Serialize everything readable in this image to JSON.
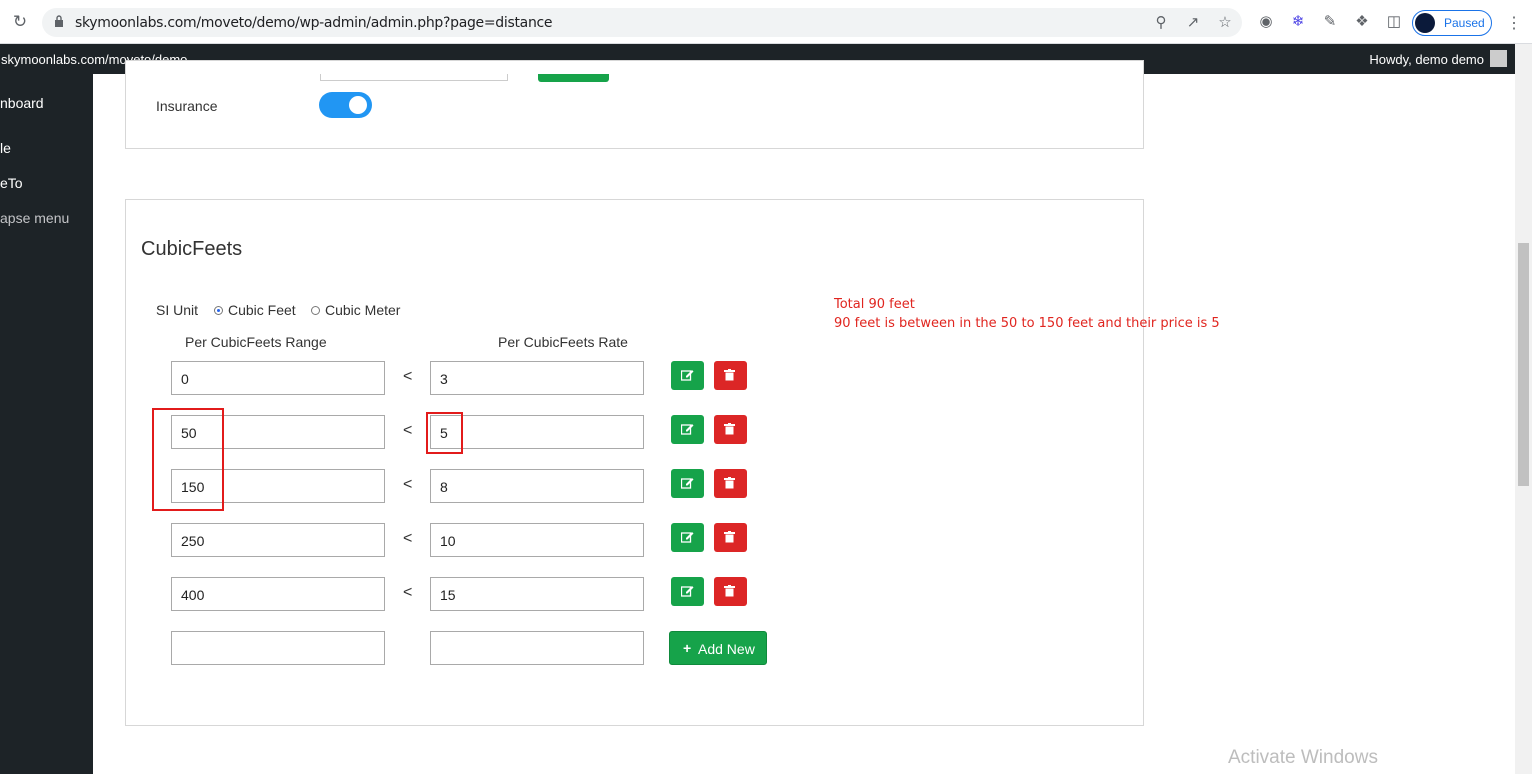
{
  "browser": {
    "url": "skymoonlabs.com/moveto/demo/wp-admin/admin.php?page=distance",
    "profile_status": "Paused"
  },
  "adminbar": {
    "site_name": "skymoonlabs.com/moveto/demo",
    "howdy": "Howdy, demo demo"
  },
  "sidebar": {
    "items": [
      "nboard",
      "le",
      "eTo",
      "apse menu"
    ]
  },
  "insurance": {
    "label": "Insurance",
    "enabled": true
  },
  "cubic": {
    "title": "CubicFeets",
    "si_label": "SI Unit",
    "options": [
      "Cubic Feet",
      "Cubic Meter"
    ],
    "selected": "Cubic Feet",
    "range_header": "Per CubicFeets Range",
    "rate_header": "Per CubicFeets Rate",
    "separator": "<",
    "rows": [
      {
        "range": "0",
        "rate": "3"
      },
      {
        "range": "50",
        "rate": "5"
      },
      {
        "range": "150",
        "rate": "8"
      },
      {
        "range": "250",
        "rate": "10"
      },
      {
        "range": "400",
        "rate": "15"
      }
    ],
    "add_label": "Add New"
  },
  "annotation": {
    "line1": "Total 90 feet",
    "line2": "90 feet is between in the 50 to 150 feet and their price is 5"
  },
  "watermark": "Activate Windows",
  "colors": {
    "accent": "#2196f3",
    "edit": "#16a34a",
    "delete": "#dc2626",
    "annotation": "#e0251f"
  }
}
